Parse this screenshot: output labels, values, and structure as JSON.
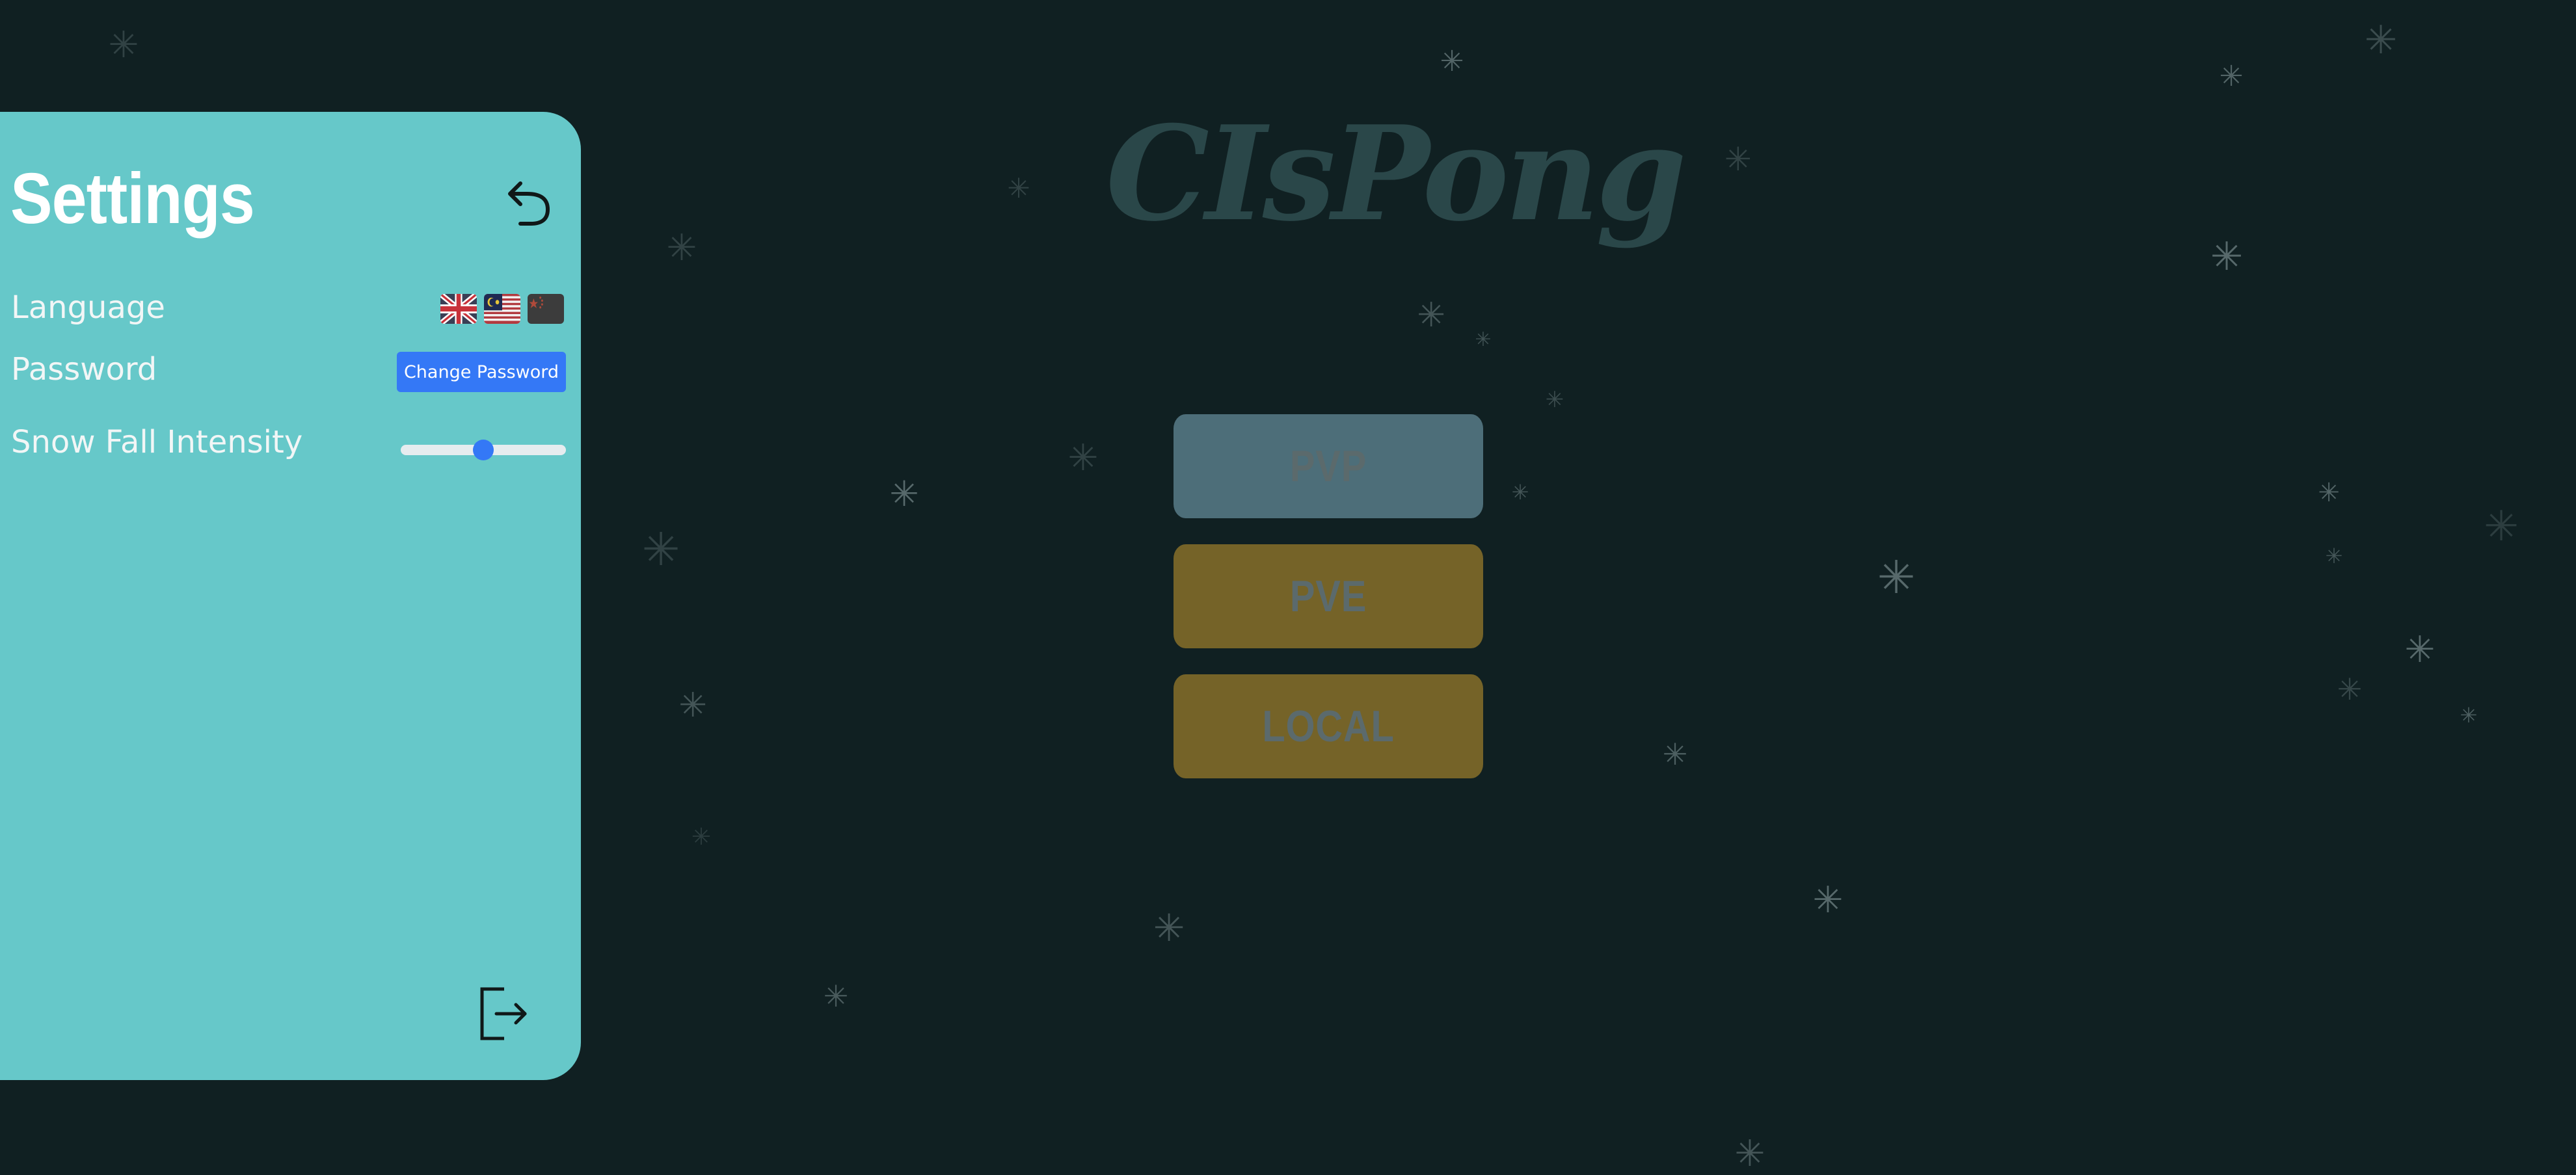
{
  "app": {
    "title": "CIsPong"
  },
  "modes": {
    "pvp_label": "PVP",
    "pve_label": "PVE",
    "local_label": "LOCAL"
  },
  "settings": {
    "title": "Settings",
    "language_label": "Language",
    "languages": [
      "English",
      "Malay",
      "Chinese"
    ],
    "password_label": "Password",
    "change_password_label": "Change Password",
    "snow_label": "Snow Fall Intensity",
    "snow_intensity_fraction": 0.5,
    "back_icon": "undo-arrow-icon",
    "logout_icon": "logout-icon"
  },
  "colors": {
    "background": "#102022",
    "panel": "#66c8c9",
    "pvp_button": "#4d6e79",
    "pve_button": "#756328",
    "local_button": "#756328",
    "accent_blue": "#3478f6",
    "snowflake": "#6f8284"
  }
}
